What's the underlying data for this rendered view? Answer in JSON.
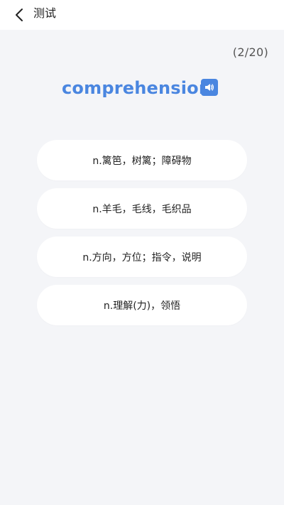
{
  "header": {
    "title": "测试",
    "back_icon": "chevron-left-icon"
  },
  "quiz": {
    "progress": "(2/20)",
    "word": "comprehension",
    "speaker_icon": "speaker-icon",
    "accent_color": "#4a86e0",
    "options": [
      {
        "label": "n.篱笆，树篱；障碍物"
      },
      {
        "label": "n.羊毛，毛线，毛织品"
      },
      {
        "label": "n.方向，方位；指令，说明"
      },
      {
        "label": "n.理解(力)，领悟"
      }
    ]
  }
}
